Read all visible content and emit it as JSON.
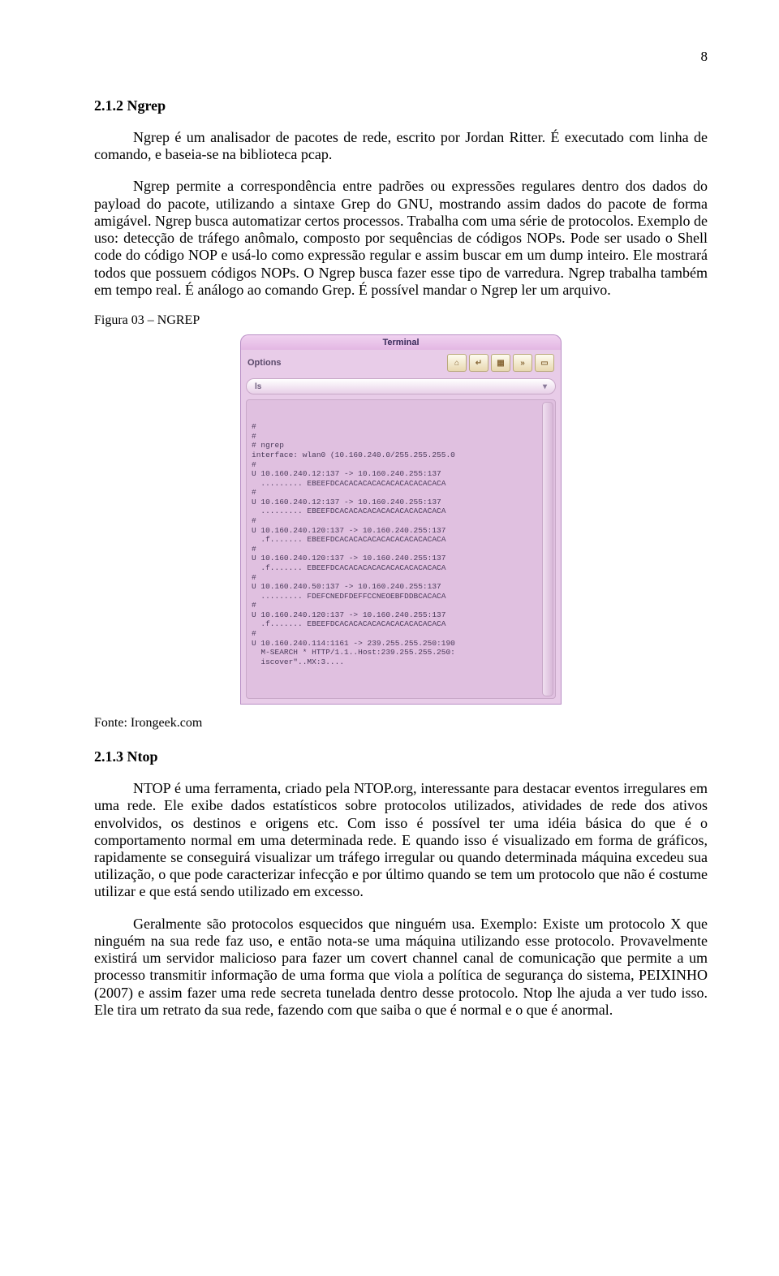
{
  "page_number": "8",
  "heading1": "2.1.2 Ngrep",
  "para1": "Ngrep é um analisador de pacotes de rede, escrito por Jordan Ritter. É executado com linha de comando, e baseia-se na biblioteca pcap.",
  "para2": "Ngrep permite a correspondência entre padrões ou expressões regulares dentro dos dados do payload do pacote, utilizando a sintaxe Grep do GNU, mostrando assim dados do pacote de forma amigável. Ngrep busca automatizar certos processos. Trabalha com uma série de protocolos. Exemplo de uso: detecção de tráfego anômalo, composto por sequências de códigos NOPs. Pode ser usado o Shell code do código NOP e usá-lo como expressão regular e assim buscar em um dump inteiro. Ele mostrará todos que possuem códigos NOPs. O Ngrep busca fazer esse tipo de varredura. Ngrep trabalha também em tempo real. É análogo ao comando Grep. É possível mandar o Ngrep ler um arquivo.",
  "fig_caption": "Figura 03 – NGREP",
  "terminal": {
    "title": "Terminal",
    "options_label": "Options",
    "pill_label": "ls",
    "lines": [
      "#",
      "#",
      "# ngrep",
      "interface: wlan0 (10.160.240.0/255.255.255.0",
      "#",
      "U 10.160.240.12:137 -> 10.160.240.255:137",
      "  ......... EBEEFDCACACACACACACACACACACACA",
      "#",
      "U 10.160.240.12:137 -> 10.160.240.255:137",
      "  ......... EBEEFDCACACACACACACACACACACACA",
      "#",
      "U 10.160.240.120:137 -> 10.160.240.255:137",
      "  .f....... EBEEFDCACACACACACACACACACACACA",
      "#",
      "U 10.160.240.120:137 -> 10.160.240.255:137",
      "  .f....... EBEEFDCACACACACACACACACACACACA",
      "#",
      "U 10.160.240.50:137 -> 10.160.240.255:137",
      "  ......... FDEFCNEDFDEFFCCNEOEBFDDBCACACA",
      "#",
      "U 10.160.240.120:137 -> 10.160.240.255:137",
      "  .f....... EBEEFDCACACACACACACACACACACACA",
      "#",
      "U 10.160.240.114:1161 -> 239.255.255.250:190",
      "  M-SEARCH * HTTP/1.1..Host:239.255.255.250:",
      "  iscover\"..MX:3...."
    ]
  },
  "source": "Fonte: Irongeek.com",
  "heading2": "2.1.3 Ntop",
  "para3": "NTOP é uma ferramenta, criado pela NTOP.org,  interessante para destacar eventos irregulares em uma rede. Ele exibe dados estatísticos sobre protocolos utilizados, atividades de rede dos ativos envolvidos, os destinos e origens etc. Com isso é possível ter uma idéia básica do que é o comportamento normal em uma determinada rede. E quando isso é visualizado em forma de gráficos, rapidamente se conseguirá visualizar um tráfego irregular ou quando determinada máquina excedeu sua utilização, o que pode caracterizar infecção e por último quando se tem um protocolo que não é costume utilizar e que está sendo utilizado em excesso.",
  "para4": "Geralmente são protocolos esquecidos que ninguém usa. Exemplo: Existe um protocolo X que ninguém na sua rede faz uso, e então nota-se uma máquina utilizando esse protocolo. Provavelmente existirá um servidor malicioso para fazer um covert channel canal de comunicação que permite a um processo transmitir informação de uma forma que viola a política de segurança do sistema, PEIXINHO (2007) e assim fazer uma rede secreta tunelada dentro desse protocolo. Ntop lhe ajuda a ver tudo isso. Ele tira um retrato da sua rede, fazendo com que saiba o que é normal e o que é anormal."
}
